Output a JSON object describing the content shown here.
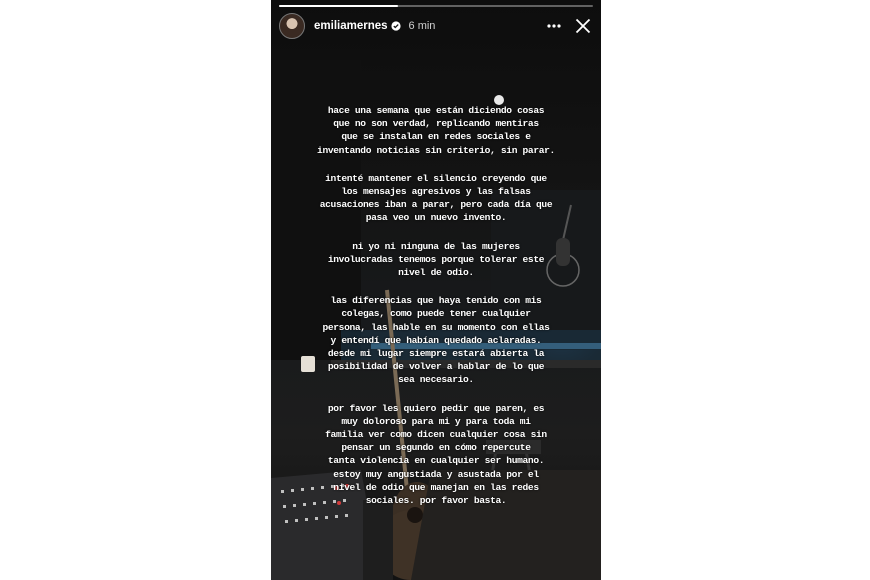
{
  "story": {
    "progress": 0.38,
    "username": "emiliamernes",
    "time": "6 min",
    "paragraphs": [
      "hace una semana que están diciendo cosas\nque no son verdad, replicando mentiras\nque se instalan en redes sociales e\ninventando noticias sin criterio, sin parar.",
      "intenté mantener el silencio creyendo que\nlos mensajes agresivos y las falsas\nacusaciones iban a parar, pero cada día que\npasa veo un nuevo invento.",
      "ni yo ni ninguna de las mujeres\ninvolucradas tenemos porque tolerar este\nnivel de odio.",
      "las diferencias que haya tenido con mis\ncolegas, como puede tener cualquier\npersona, las hable en su momento con ellas\ny entendí que habían quedado aclaradas.\ndesde mi lugar siempre estará abierta la\nposibilidad de volver a hablar de lo que\nsea necesario.",
      "por favor les quiero pedir que paren, es\nmuy doloroso para mi y para toda mi\nfamilia ver como dicen cualquier cosa sin\npensar un segundo en cómo repercute\ntanta violencia en cualquier ser humano.\nestoy muy angustiada y asustada por el\nnivel de odio que manejan en las redes\nsociales. por favor basta."
    ]
  },
  "icons": {
    "verified": "verified-badge-icon",
    "more": "more-horizontal-icon",
    "close": "close-icon"
  },
  "colors": {
    "text": "#ffffff",
    "background": "#141414"
  }
}
